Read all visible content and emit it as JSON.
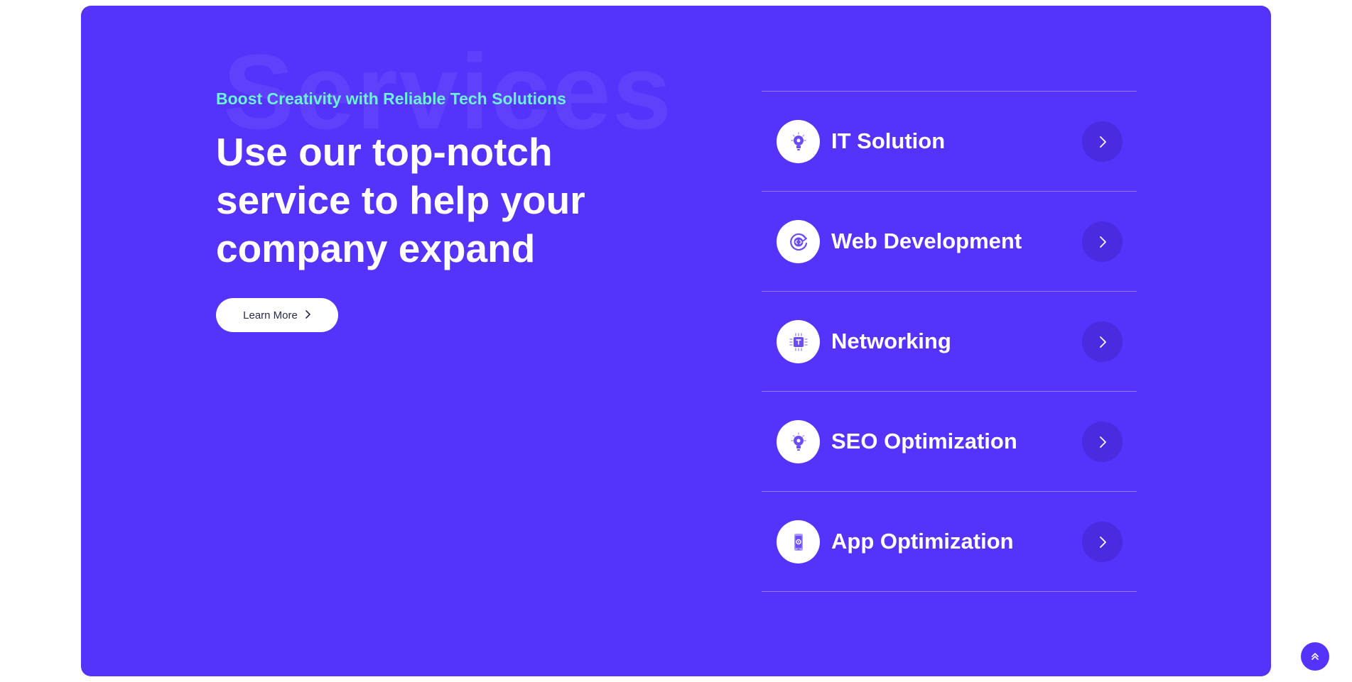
{
  "hero": {
    "watermark": "Services",
    "eyebrow": "Boost Creativity with Reliable Tech Solutions",
    "headline": "Use our top-notch service to help your company expand",
    "learn_more_label": "Learn More"
  },
  "services": [
    {
      "title": "IT Solution",
      "icon": "lightbulb-icon"
    },
    {
      "title": "Web Development",
      "icon": "code-refresh-icon"
    },
    {
      "title": "Networking",
      "icon": "chip-icon"
    },
    {
      "title": "SEO Optimization",
      "icon": "lightbulb-icon"
    },
    {
      "title": "App Optimization",
      "icon": "mobile-gear-icon"
    }
  ],
  "colors": {
    "panel": "#5433fb",
    "accent_text": "#6ef0d4",
    "arrow_circle": "#4a2be0"
  }
}
